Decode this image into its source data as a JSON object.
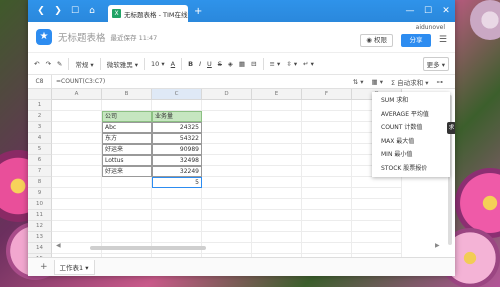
{
  "browser": {
    "tab_title": "无标题表格 - TIM在线文档",
    "tab_icon": "X",
    "add_tab": "+"
  },
  "app": {
    "title": "无标题表格",
    "save_status": "最近保存 11:47",
    "user": "aidunovel",
    "permission_button": "权限",
    "share_button": "分享"
  },
  "toolbar": {
    "format": "常规",
    "font": "微软雅黑",
    "size": "10",
    "more": "更多"
  },
  "formula_bar": {
    "cell_ref": "C8",
    "formula": "=COUNT(C3:C7)",
    "autosum_label": "自动求和"
  },
  "grid": {
    "columns": [
      "A",
      "B",
      "C",
      "D",
      "E",
      "F",
      "G"
    ],
    "row_numbers": [
      "1",
      "2",
      "3",
      "4",
      "5",
      "6",
      "7",
      "8",
      "9",
      "10",
      "11",
      "12",
      "13",
      "14",
      "15"
    ],
    "header_row": {
      "col_b": "公司",
      "col_c": "业务量"
    },
    "rows": [
      {
        "company": "Abc",
        "amount": "24325"
      },
      {
        "company": "东方",
        "amount": "54322"
      },
      {
        "company": "好运来",
        "amount": "90989"
      },
      {
        "company": "Lottus",
        "amount": "32498"
      },
      {
        "company": "好运来",
        "amount": "32249"
      }
    ],
    "active_value": "5"
  },
  "autosum_menu": {
    "items": [
      "SUM 求和",
      "AVERAGE 平均值",
      "COUNT 计数值",
      "MAX 最大值",
      "MIN 最小值",
      "STOCK 股票报价"
    ],
    "tooltip": "求"
  },
  "sheets": {
    "add": "+",
    "tabs": [
      "工作表1"
    ]
  }
}
